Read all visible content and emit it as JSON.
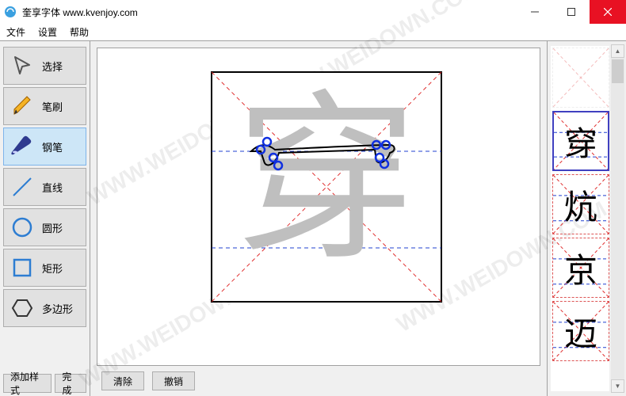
{
  "window": {
    "title": "奎享字体 www.kvenjoy.com"
  },
  "menu": {
    "items": [
      "文件",
      "设置",
      "帮助"
    ]
  },
  "tools": {
    "select": "选择",
    "brush": "笔刷",
    "pen": "钢笔",
    "line": "直线",
    "circle": "圆形",
    "rect": "矩形",
    "polygon": "多边形"
  },
  "toolbox_buttons": {
    "add_style": "添加样式",
    "finish": "完成"
  },
  "canvas": {
    "reference_char": "穿",
    "actions": {
      "clear": "清除",
      "undo": "撤销"
    }
  },
  "glyphs": {
    "items": [
      "穿",
      "炕",
      "京",
      "迈"
    ]
  },
  "colors": {
    "accent": "#2d7dd2",
    "guide_red": "#e03030",
    "guide_blue": "#2040d0",
    "close": "#e81123"
  },
  "watermark": "WWW.WEIDOWN.COM"
}
